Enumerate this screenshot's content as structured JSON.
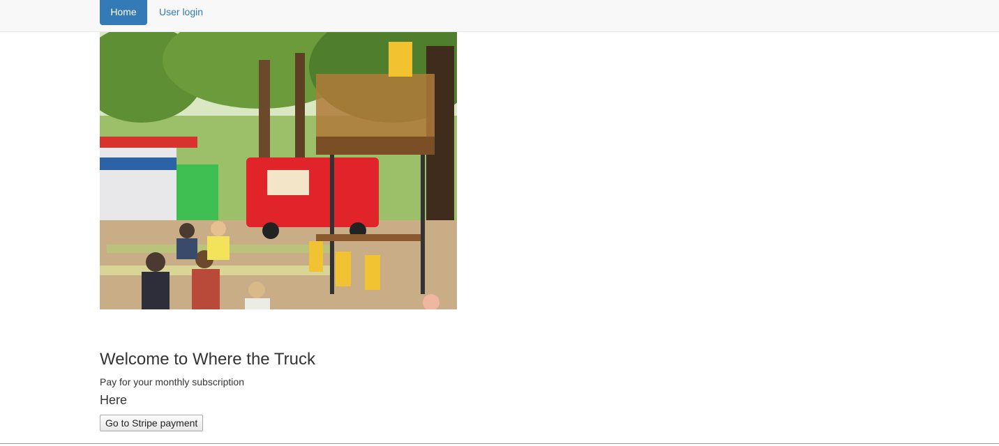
{
  "navbar": {
    "home_label": "Home",
    "login_label": "User login"
  },
  "hero": {
    "image_description_icon": "food-truck-park-photo"
  },
  "content": {
    "welcome_heading": "Welcome to Where the Truck",
    "subscription_text": "Pay for your monthly subscription",
    "here_heading": "Here",
    "stripe_button_label": "Go to Stripe payment"
  },
  "colors": {
    "primary": "#337ab7",
    "navbar_bg": "#f8f8f8",
    "text": "#333333"
  }
}
